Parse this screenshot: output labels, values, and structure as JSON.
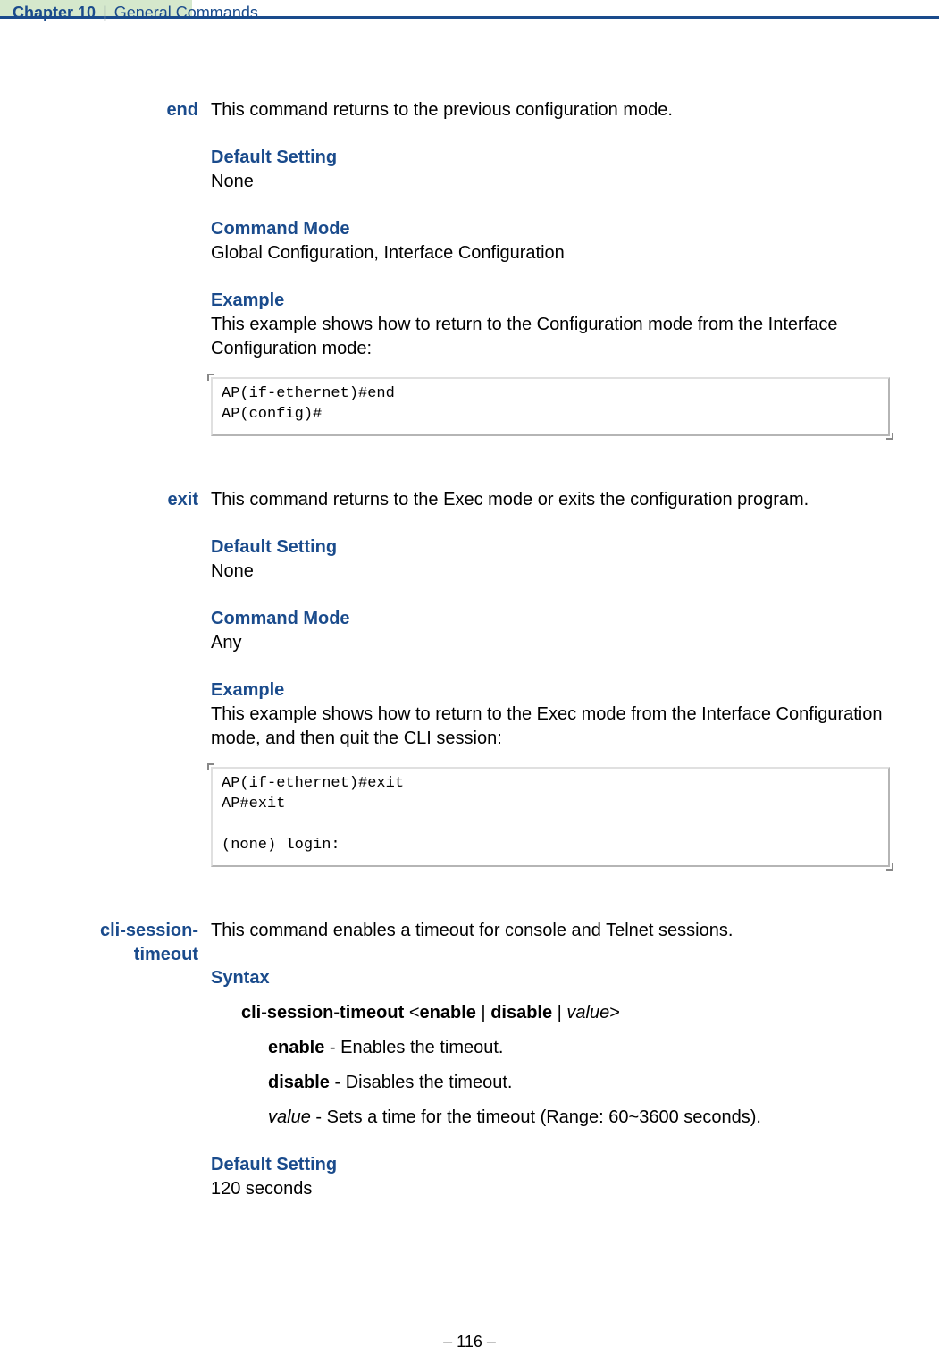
{
  "header": {
    "chapter": "Chapter 10",
    "separator": "|",
    "section": "General Commands"
  },
  "sections": [
    {
      "command": "end",
      "desc": "This command returns to the previous configuration mode.",
      "default_label": "Default Setting",
      "default_val": "None",
      "mode_label": "Command Mode",
      "mode_val": "Global Configuration, Interface Configuration",
      "example_label": "Example",
      "example_desc": "This example shows how to return to the Configuration mode from the Interface Configuration mode:",
      "code": "AP(if-ethernet)#end\nAP(config)#"
    },
    {
      "command": "exit",
      "desc": "This command returns to the Exec mode or exits the configuration program.",
      "default_label": "Default Setting",
      "default_val": "None",
      "mode_label": "Command Mode",
      "mode_val": "Any",
      "example_label": "Example",
      "example_desc": "This example shows how to return to the Exec mode from the Interface Configuration mode, and then quit the CLI session:",
      "code": "AP(if-ethernet)#exit\nAP#exit\n\n(none) login:"
    },
    {
      "command": "cli-session-timeout",
      "desc": "This command enables a timeout for console and Telnet sessions.",
      "syntax_label": "Syntax",
      "syntax_line": {
        "cmd_bold": "cli-session-timeout",
        "open": " <",
        "opt1_bold": "enable",
        "sep1": " | ",
        "opt2_bold": "disable",
        "sep2": " | ",
        "opt3_ital": "value",
        "close": ">"
      },
      "params": [
        {
          "term_bold": "enable",
          "rest": " - Enables the timeout."
        },
        {
          "term_bold": "disable",
          "rest": " - Disables the timeout."
        },
        {
          "term_ital": "value",
          "rest": " - Sets a time for the timeout (Range: 60~3600 seconds)."
        }
      ],
      "default_label": "Default Setting",
      "default_val": "120 seconds"
    }
  ],
  "footer": {
    "left": "–  ",
    "page": "116",
    "right": "  –"
  }
}
